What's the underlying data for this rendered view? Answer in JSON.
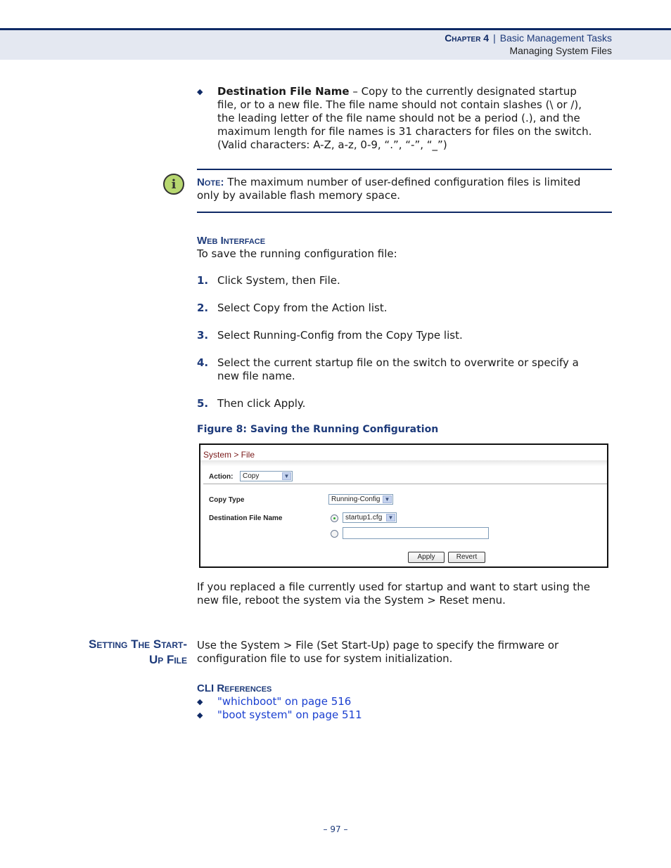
{
  "header": {
    "chapter": "Chapter 4",
    "separator": "|",
    "chapter_title": "Basic Management Tasks",
    "section": "Managing System Files"
  },
  "destination_bullet": {
    "term": "Destination File Name",
    "lines": [
      " – Copy to the currently designated startup",
      "file, or to a new file. The file name should not contain slashes (\\ or /),",
      "the leading letter of the file name should not be a period (.), and the",
      "maximum length for file names is 31 characters for files on the switch.",
      "(Valid characters: A-Z, a-z, 0-9, “.”, “-”, “_”)"
    ]
  },
  "note": {
    "icon": "info-icon",
    "label": "Note:",
    "line1": " The maximum number of user-defined configuration files is limited",
    "line2": "only by available flash memory space."
  },
  "web_interface": {
    "heading": "Web Interface",
    "intro": "To save the running configuration file:",
    "steps": [
      {
        "num": "1.",
        "text": "Click System, then File."
      },
      {
        "num": "2.",
        "text": "Select Copy from the Action list."
      },
      {
        "num": "3.",
        "text": "Select Running-Config from the Copy Type list."
      },
      {
        "num": "4.",
        "text": "Select the current startup file on the switch to overwrite or specify a",
        "text2": "new file name."
      },
      {
        "num": "5.",
        "text": "Then click Apply."
      }
    ]
  },
  "figure": {
    "caption": "Figure 8:  Saving the Running Configuration",
    "title": "System > File",
    "action_label": "Action:",
    "action_value": "Copy",
    "copy_type_label": "Copy Type",
    "copy_type_value": "Running-Config",
    "dest_label": "Destination File Name",
    "dest_select_value": "startup1.cfg",
    "dest_text_value": "",
    "apply_label": "Apply",
    "revert_label": "Revert",
    "dropdown_arrow": "▼"
  },
  "after_figure": {
    "line1": "If you replaced a file currently used for startup and want to start using the",
    "line2": "new file, reboot the system via the System > Reset menu."
  },
  "startup_section": {
    "heading_line1": "Setting The Start-",
    "heading_line2": "Up File",
    "line1": "Use the System > File (Set Start-Up) page to specify the firmware or",
    "line2": "configuration file to use for system initialization.",
    "cli_heading": "CLI References",
    "cli_refs": [
      "\"whichboot\" on page 516",
      "\"boot system\" on page 511"
    ]
  },
  "footer": {
    "page_number": "–  97  –"
  }
}
